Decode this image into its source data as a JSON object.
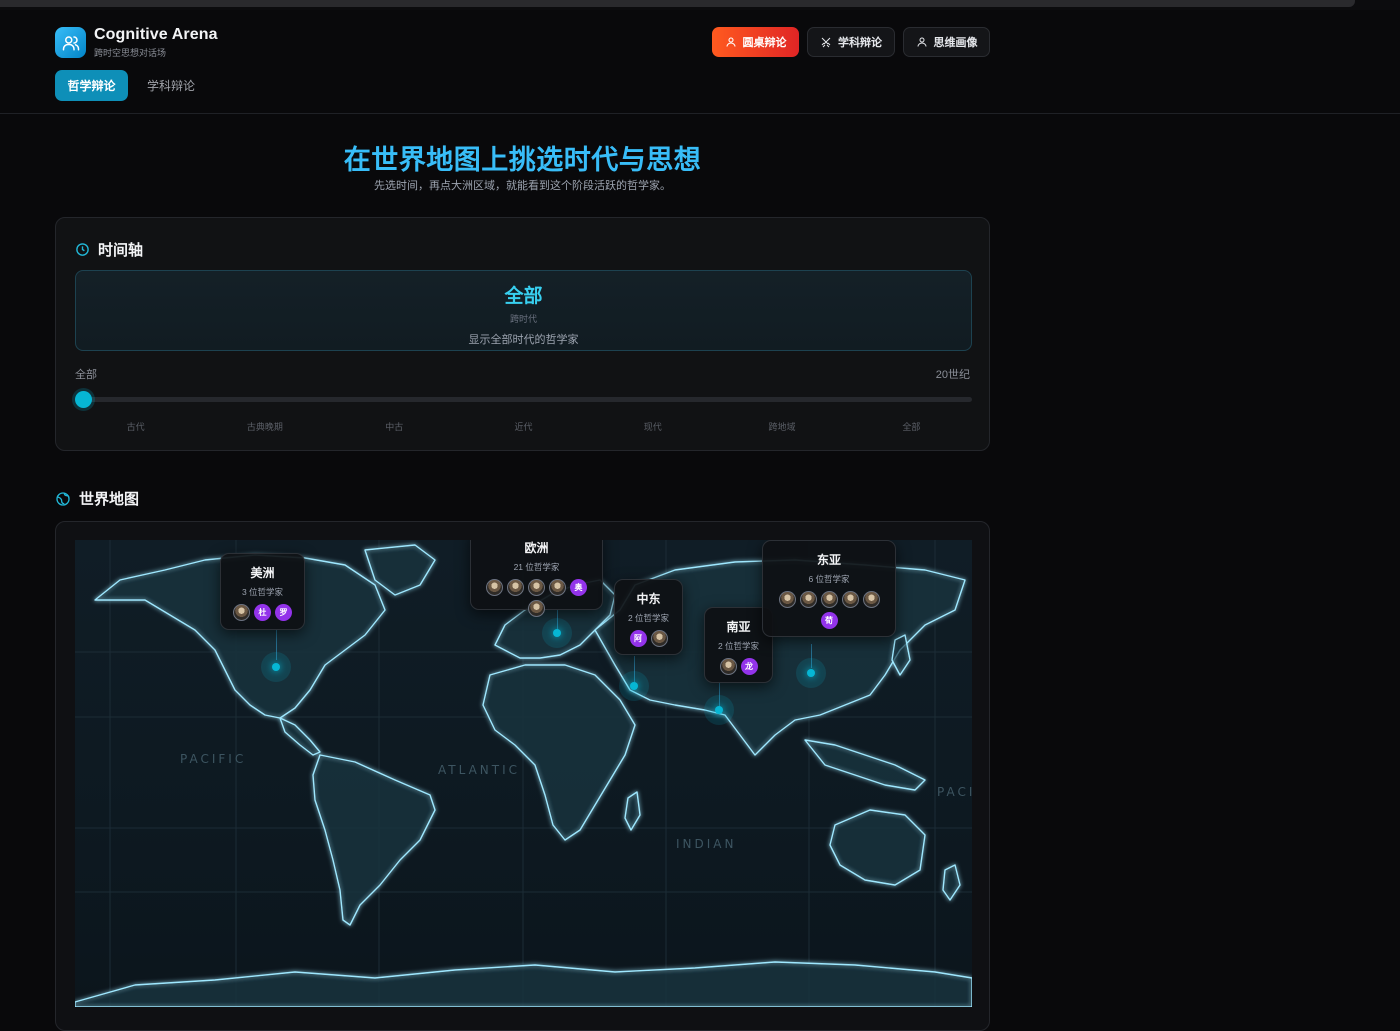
{
  "app": {
    "title": "Cognitive Arena",
    "subtitle": "跨时空思想对话场",
    "logo_icon": "users-icon"
  },
  "nav_buttons": [
    {
      "label": "圆桌辩论",
      "icon": "user-icon",
      "color": "#ff5a1f"
    },
    {
      "label": "学科辩论",
      "icon": "crossed-swords-icon"
    },
    {
      "label": "思维画像",
      "icon": "user-icon"
    }
  ],
  "tabs": [
    {
      "label": "哲学辩论",
      "active": true
    },
    {
      "label": "学科辩论",
      "active": false
    }
  ],
  "hero": {
    "title": "在世界地图上挑选时代与思想",
    "subtitle": "先选时间，再点大洲区域，就能看到这个阶段活跃的哲学家。"
  },
  "timeline": {
    "title": "时间轴",
    "icon": "clock-icon",
    "selected": {
      "name": "全部",
      "period": "跨时代",
      "description": "显示全部时代的哲学家"
    },
    "range_start": "全部",
    "range_end": "20世纪",
    "slider_position": 0,
    "ticks": [
      "古代",
      "古典晚期",
      "中古",
      "近代",
      "现代",
      "跨地域",
      "全部"
    ]
  },
  "world_map": {
    "title": "世界地图",
    "icon": "globe-icon",
    "oceans": [
      "PACIFIC",
      "ATLANTIC",
      "INDIAN",
      "PACIFI"
    ],
    "regions": [
      {
        "name": "美洲",
        "count": "3 位哲学家",
        "portraits": 1,
        "letters": [
          "杜",
          "罗"
        ]
      },
      {
        "name": "欧洲",
        "count": "21 位哲学家",
        "portraits": 4,
        "letters": [
          "奥"
        ],
        "extra_portraits": 1
      },
      {
        "name": "中东",
        "count": "2 位哲学家",
        "portraits": 0,
        "letters": [
          "阿"
        ],
        "extra_portraits": 1
      },
      {
        "name": "南亚",
        "count": "2 位哲学家",
        "portraits": 1,
        "letters": [
          "龙"
        ]
      },
      {
        "name": "东亚",
        "count": "6 位哲学家",
        "portraits": 5,
        "letters": [
          "荀"
        ]
      }
    ]
  }
}
